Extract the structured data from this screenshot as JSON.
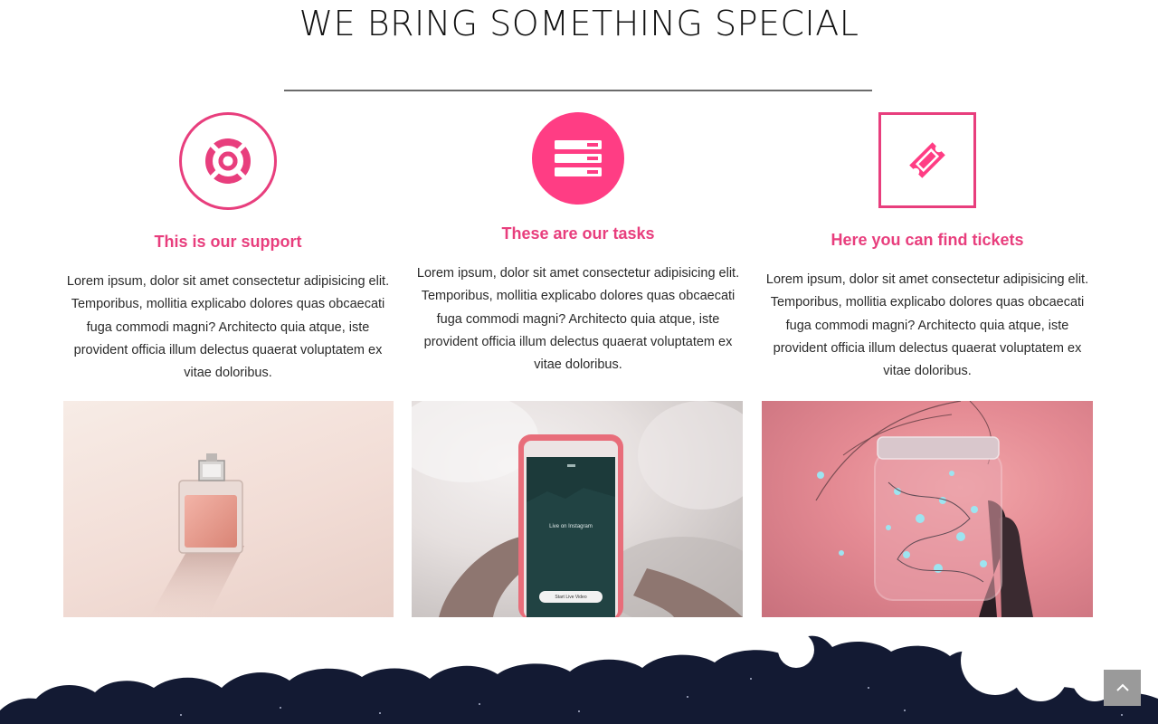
{
  "section": {
    "title": "WE BRING SOMETHING SPECIAL"
  },
  "features": [
    {
      "icon": "lifebuoy-icon",
      "title": "This is our support",
      "text": "Lorem ipsum, dolor sit amet consectetur adipisicing elit. Temporibus, mollitia explicabo dolores quas obcaecati fuga commodi magni? Architecto quia atque, iste provident officia illum delectus quaerat voluptatem ex vitae doloribus."
    },
    {
      "icon": "server-stack-icon",
      "title": "These are our tasks",
      "text": "Lorem ipsum, dolor sit amet consectetur adipisicing elit. Temporibus, mollitia explicabo dolores quas obcaecati fuga commodi magni? Architecto quia atque, iste provident officia illum delectus quaerat voluptatem ex vitae doloribus."
    },
    {
      "icon": "ticket-icon",
      "title": "Here you can find tickets",
      "text": "Lorem ipsum, dolor sit amet consectetur adipisicing elit. Temporibus, mollitia explicabo dolores quas obcaecati fuga commodi magni? Architecto quia atque, iste provident officia illum delectus quaerat voluptatem ex vitae doloribus."
    }
  ],
  "gallery": {
    "phone_screen_title": "Live on Instagram",
    "phone_button": "Start Live Video"
  },
  "colors": {
    "accent": "#e83e7d",
    "accent_fill": "#ff3d84",
    "night_sky": "#141a33",
    "back_to_top": "#9a9a9a"
  },
  "back_to_top": {
    "icon": "chevron-up-icon"
  }
}
